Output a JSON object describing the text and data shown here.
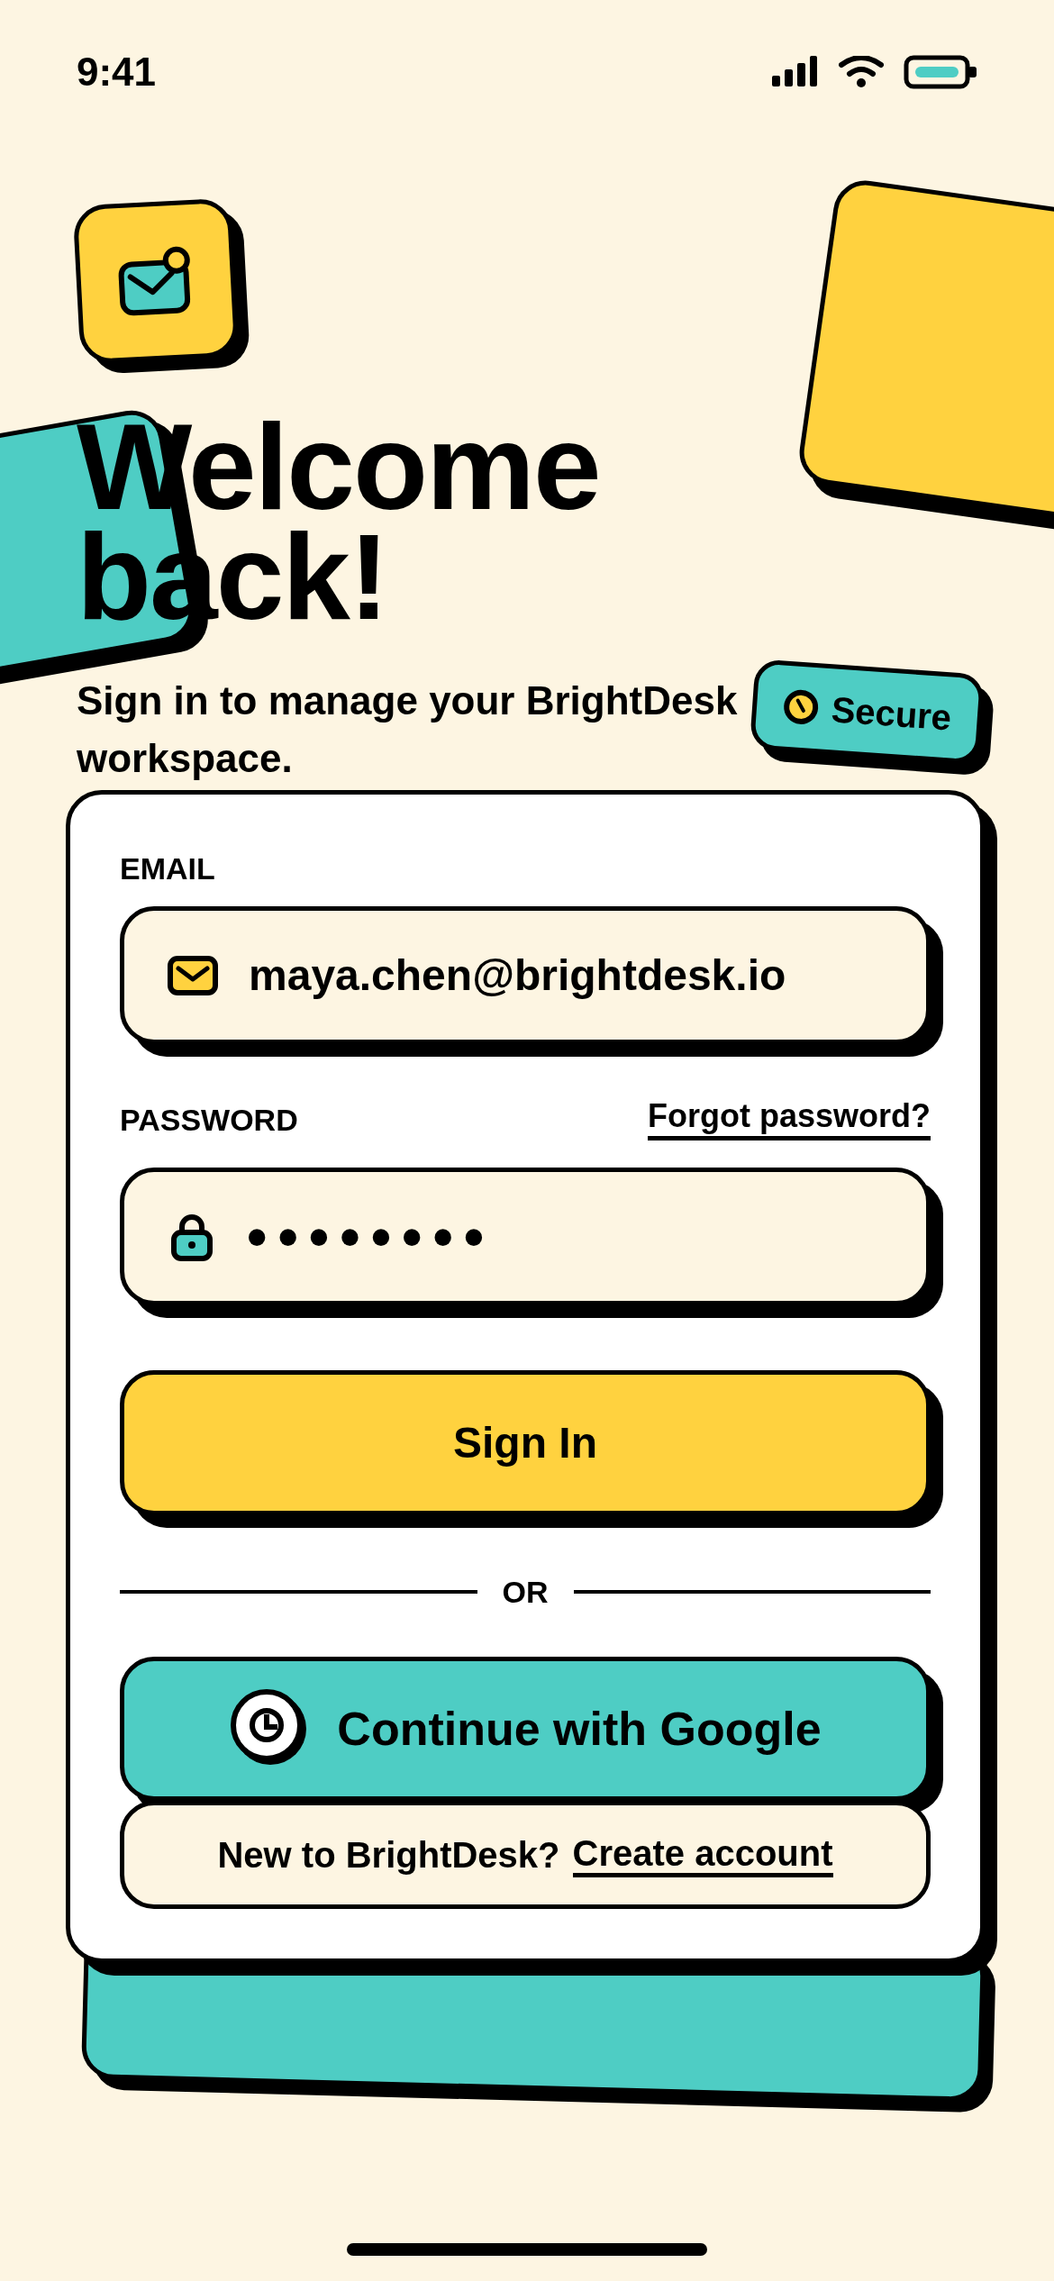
{
  "status_bar": {
    "time": "9:41"
  },
  "heading": "Welcome back!",
  "subtitle": "Sign in to manage your BrightDesk workspace.",
  "badge": {
    "label": "Secure"
  },
  "form": {
    "email": {
      "label": "EMAIL",
      "value": "maya.chen@brightdesk.io"
    },
    "password": {
      "label": "PASSWORD",
      "value": "••••••••",
      "forgot_link": "Forgot password?"
    },
    "sign_in_button": "Sign In",
    "divider": "OR",
    "google_button": "Continue with Google",
    "signup": {
      "prompt": "New to BrightDesk?",
      "link": "Create account"
    }
  }
}
